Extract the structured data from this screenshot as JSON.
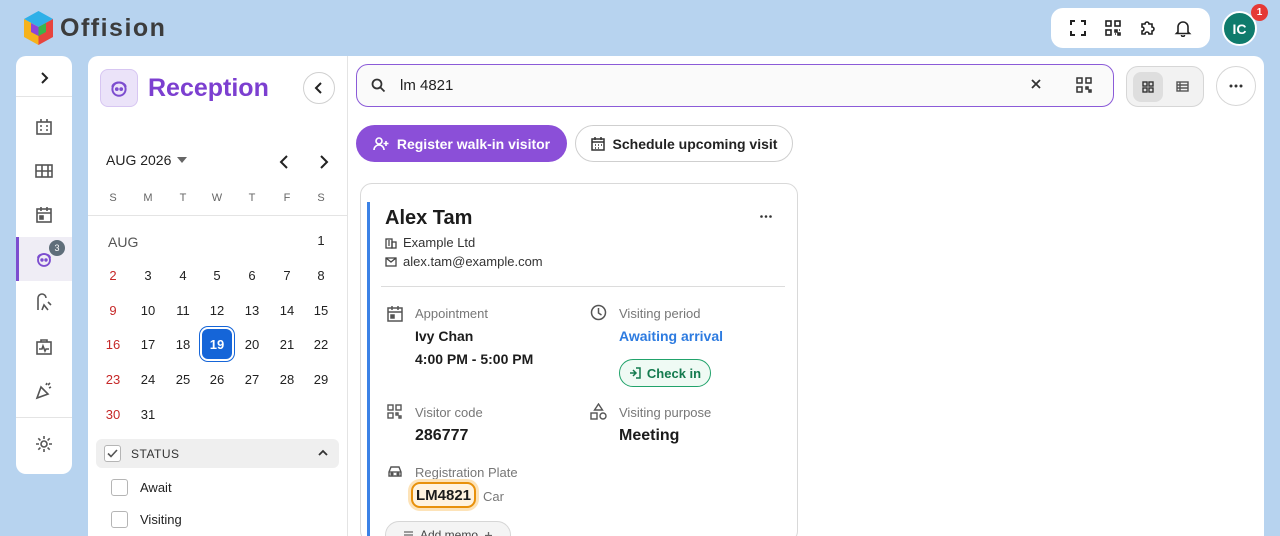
{
  "header": {
    "brand": "Offision",
    "actions": [
      "fullscreen-icon",
      "qr-scan-icon",
      "puzzle-icon",
      "bell-icon"
    ],
    "avatar_initials": "IC",
    "notification_count": "1"
  },
  "rail": {
    "expand_icon": "chevron-right-icon",
    "items": [
      {
        "icon": "building-icon"
      },
      {
        "icon": "desk-icon"
      },
      {
        "icon": "calendar-icon"
      },
      {
        "icon": "reception-icon",
        "badge": "3",
        "active": true
      },
      {
        "icon": "parking-icon"
      },
      {
        "icon": "health-icon"
      },
      {
        "icon": "party-icon"
      }
    ],
    "settings_icon": "gear-icon"
  },
  "sidebar": {
    "title": "Reception",
    "calendar": {
      "month_label": "AUG 2026",
      "month_tag": "AUG",
      "weekdays": [
        "S",
        "M",
        "T",
        "W",
        "T",
        "F",
        "S"
      ],
      "selected_day": "19",
      "days": [
        "1",
        "2",
        "3",
        "4",
        "5",
        "6",
        "7",
        "8",
        "9",
        "10",
        "11",
        "12",
        "13",
        "14",
        "15",
        "16",
        "17",
        "18",
        "19",
        "20",
        "21",
        "22",
        "23",
        "24",
        "25",
        "26",
        "27",
        "28",
        "29",
        "30",
        "31"
      ]
    },
    "status": {
      "label": "STATUS",
      "options": [
        "Await",
        "Visiting"
      ]
    }
  },
  "main": {
    "search": {
      "value": "lm 4821",
      "placeholder": ""
    },
    "buttons": {
      "register": "Register walk-in visitor",
      "schedule": "Schedule upcoming visit"
    },
    "card": {
      "name": "Alex Tam",
      "company": "Example Ltd",
      "email": "alex.tam@example.com",
      "appointment_label": "Appointment",
      "host": "Ivy Chan",
      "time": "4:00 PM - 5:00 PM",
      "period_label": "Visiting period",
      "period_value": "Awaiting arrival",
      "checkin_label": "Check in",
      "code_label": "Visitor code",
      "code_value": "286777",
      "purpose_label": "Visiting purpose",
      "purpose_value": "Meeting",
      "plate_label": "Registration Plate",
      "plate_value": "LM4821",
      "plate_type": "Car",
      "memo_label": "Add memo"
    }
  },
  "colors": {
    "accent": "#8b4fd8",
    "link": "#2d7be0",
    "selected_day": "#1565d8",
    "checkin_green": "#21a36b",
    "plate_highlight": "#e8910b",
    "background": "#b7d3ef"
  }
}
